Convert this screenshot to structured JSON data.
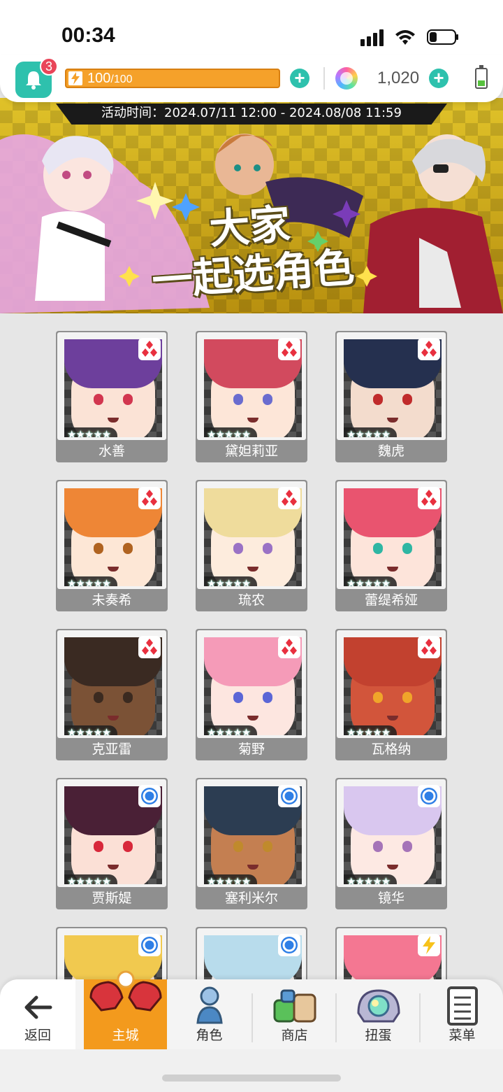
{
  "status_bar": {
    "time": "00:34"
  },
  "header": {
    "notification_count": "3",
    "energy_current": "100",
    "energy_max": "/100",
    "gems": "1,020"
  },
  "banner": {
    "event_time": "活动时间：2024.07/11 12:00 - 2024.08/08 11:59",
    "title_line1": "大家",
    "title_line2": "一起选角色"
  },
  "characters": [
    {
      "name": "水善",
      "rarity": "★★★★★",
      "attribute": "diamond-icon",
      "hair": "#6d3f9c",
      "eye": "#d2364f",
      "skin": "#fbe3d6"
    },
    {
      "name": "黛妲莉亚",
      "rarity": "★★★★★",
      "attribute": "diamond-icon",
      "hair": "#d24a5e",
      "eye": "#6a6ccf",
      "skin": "#fde6d8"
    },
    {
      "name": "魏虎",
      "rarity": "★★★★★",
      "attribute": "diamond-icon",
      "hair": "#25304f",
      "eye": "#c02b2b",
      "skin": "#f3dccd"
    },
    {
      "name": "未奏希",
      "rarity": "★★★★★",
      "attribute": "diamond-icon",
      "hair": "#ee8636",
      "eye": "#b06320",
      "skin": "#fde7d6"
    },
    {
      "name": "琉农",
      "rarity": "★★★★★",
      "attribute": "diamond-icon",
      "hair": "#efdc9c",
      "eye": "#9a72c5",
      "skin": "#fdecdd"
    },
    {
      "name": "蕾缇希娅",
      "rarity": "★★★★★",
      "attribute": "diamond-icon",
      "hair": "#e9546f",
      "eye": "#2fb6a3",
      "skin": "#fde4da"
    },
    {
      "name": "克亚雷",
      "rarity": "★★★★★",
      "attribute": "diamond-icon",
      "hair": "#3a2a22",
      "eye": "#3b2a20",
      "skin": "#7b5236"
    },
    {
      "name": "菊野",
      "rarity": "★★★★★",
      "attribute": "diamond-icon",
      "hair": "#f59bb8",
      "eye": "#5b66d6",
      "skin": "#fde6e0"
    },
    {
      "name": "瓦格纳",
      "rarity": "★★★★★",
      "attribute": "diamond-icon",
      "hair": "#c2412f",
      "eye": "#f0a52a",
      "skin": "#d2553b"
    },
    {
      "name": "贾斯媞",
      "rarity": "★★★★★",
      "attribute": "circle-icon",
      "hair": "#4a2036",
      "eye": "#d8283a",
      "skin": "#fbe0d6"
    },
    {
      "name": "塞利米尔",
      "rarity": "★★★★★",
      "attribute": "circle-icon",
      "hair": "#2c3d52",
      "eye": "#c08a2c",
      "skin": "#c47f51"
    },
    {
      "name": "镜华",
      "rarity": "★★★★★",
      "attribute": "circle-icon",
      "hair": "#d9c7ef",
      "eye": "#a574b8",
      "skin": "#fde9e3"
    },
    {
      "name": "",
      "rarity": "",
      "attribute": "circle-icon",
      "hair": "#f1c94f",
      "eye": "#3c6bb8",
      "skin": "#fbe2d0"
    },
    {
      "name": "",
      "rarity": "",
      "attribute": "circle-icon",
      "hair": "#b8dcec",
      "eye": "#5aa6c8",
      "skin": "#f4f0ef"
    },
    {
      "name": "",
      "rarity": "",
      "attribute": "lightning-icon",
      "hair": "#f47792",
      "eye": "#4a7ad6",
      "skin": "#fde3dc"
    }
  ],
  "nav": {
    "back": "返回",
    "home": "主城",
    "character": "角色",
    "shop": "商店",
    "gacha": "扭蛋",
    "menu": "菜单"
  },
  "colors": {
    "accent_teal": "#2ec1ad",
    "energy_orange": "#f5a12a",
    "nav_active": "#f39a1d",
    "diamond_red": "#e8303f",
    "circle_blue": "#2f7fe6",
    "lightning_yellow": "#f7c21a"
  }
}
